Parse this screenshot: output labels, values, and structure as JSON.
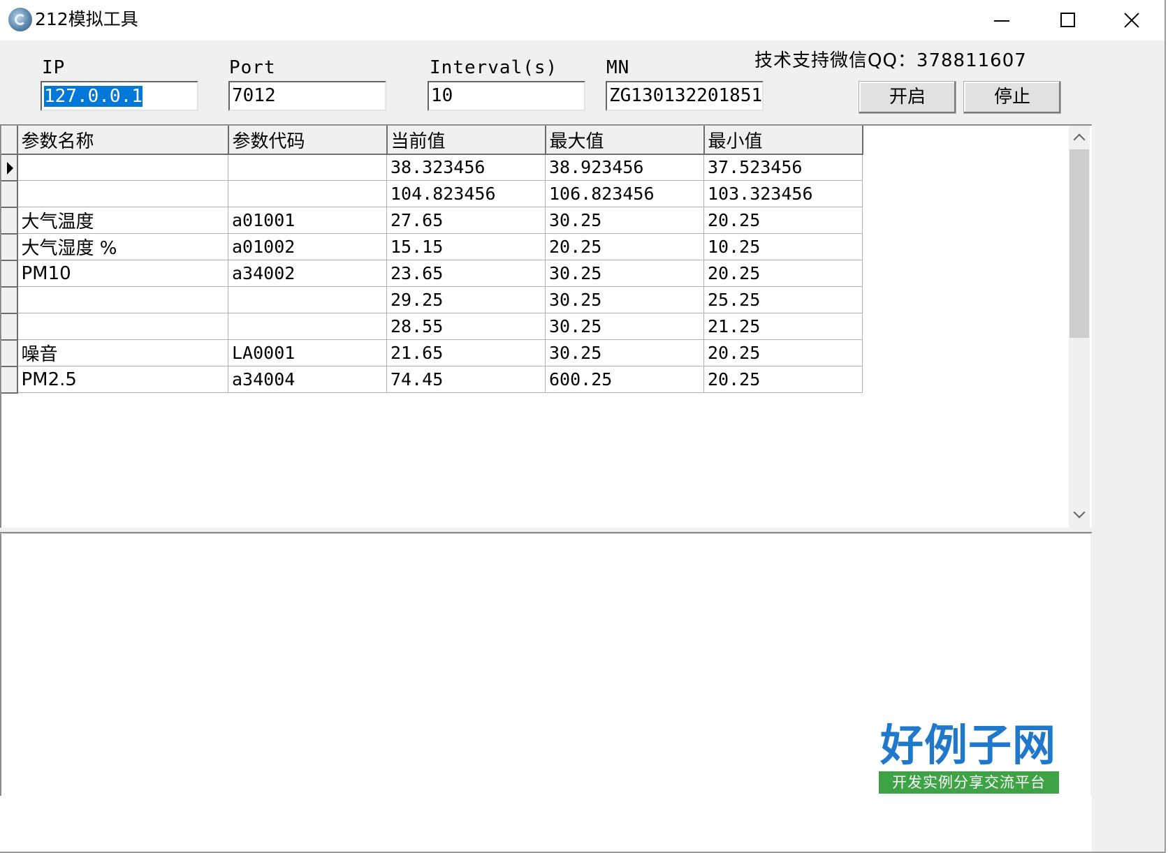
{
  "window": {
    "title": "212模拟工具",
    "controls": {
      "minimize": "minimize",
      "maximize": "maximize",
      "close": "close"
    }
  },
  "config": {
    "ip_label": "IP",
    "ip_value": "127.0.0.1",
    "port_label": "Port",
    "port_value": "7012",
    "interval_label": "Interval(s)",
    "interval_value": "10",
    "mn_label": "MN",
    "mn_value": "ZG130132201851",
    "support_text": "技术支持微信QQ：378811607",
    "start_label": "开启",
    "stop_label": "停止"
  },
  "grid": {
    "columns": [
      "参数名称",
      "参数代码",
      "当前值",
      "最大值",
      "最小值"
    ],
    "rows": [
      [
        "",
        "",
        "38.323456",
        "38.923456",
        "37.523456"
      ],
      [
        "",
        "",
        "104.823456",
        "106.823456",
        "103.323456"
      ],
      [
        "大气温度",
        "a01001",
        "27.65",
        "30.25",
        "20.25"
      ],
      [
        "大气湿度 %",
        "a01002",
        "15.15",
        "20.25",
        "10.25"
      ],
      [
        "PM10",
        "a34002",
        "23.65",
        "30.25",
        "20.25"
      ],
      [
        "",
        "",
        "29.25",
        "30.25",
        "25.25"
      ],
      [
        "",
        "",
        "28.55",
        "30.25",
        "21.25"
      ],
      [
        "噪音",
        "LA0001",
        "21.65",
        "30.25",
        "20.25"
      ],
      [
        "PM2.5",
        "a34004",
        "74.45",
        "600.25",
        "20.25"
      ]
    ],
    "current_row": 0
  },
  "log": {
    "text": ""
  },
  "watermark": {
    "logo_main": "好例子网",
    "logo_sub": "开发实例分享交流平台"
  },
  "icons": {
    "app": "app-globe-icon",
    "row_pointer": "row-pointer-icon",
    "scroll_up": "scroll-up-arrow-icon",
    "scroll_down": "scroll-down-arrow-icon"
  }
}
